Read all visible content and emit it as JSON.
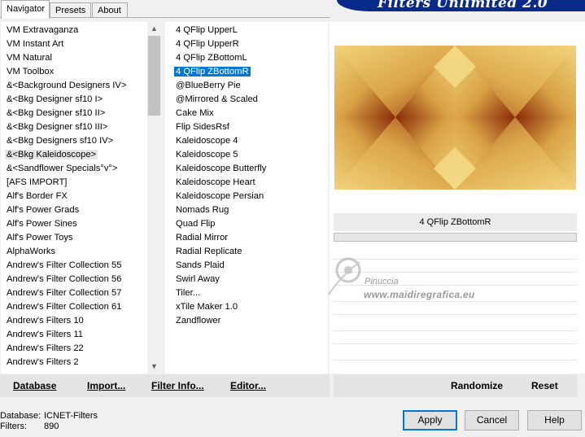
{
  "tabs": [
    "Navigator",
    "Presets",
    "About"
  ],
  "banner_title": "Filters Unlimited 2.0",
  "categories": [
    "VM Extravaganza",
    "VM Instant Art",
    "VM Natural",
    "VM Toolbox",
    "&<Background Designers IV>",
    "&<Bkg Designer sf10 I>",
    "&<Bkg Designer sf10 II>",
    "&<Bkg Designer sf10 III>",
    "&<Bkg Designers sf10 IV>",
    "&<Bkg Kaleidoscope>",
    "&<Sandflower Specials°v°>",
    "[AFS IMPORT]",
    "Alf's Border FX",
    "Alf's Power Grads",
    "Alf's Power Sines",
    "Alf's Power Toys",
    "AlphaWorks",
    "Andrew's Filter Collection 55",
    "Andrew's Filter Collection 56",
    "Andrew's Filter Collection 57",
    "Andrew's Filter Collection 61",
    "Andrew's Filters 10",
    "Andrew's Filters 11",
    "Andrew's Filters 22",
    "Andrew's Filters 2"
  ],
  "selected_category": "&<Bkg Kaleidoscope>",
  "filters": [
    "4 QFlip UpperL",
    "4 QFlip UpperR",
    "4 QFlip ZBottomL",
    "4 QFlip ZBottomR",
    "@BlueBerry Pie",
    "@Mirrored & Scaled",
    "Cake Mix",
    "Flip SidesRsf",
    "Kaleidoscope 4",
    "Kaleidoscope 5",
    "Kaleidoscope Butterfly",
    "Kaleidoscope Heart",
    "Kaleidoscope Persian",
    "Nomads Rug",
    "Quad Flip",
    "Radial Mirror",
    "Radial Replicate",
    "Sands Plaid",
    "Swirl Away",
    "Tiler...",
    "xTile Maker 1.0",
    "Zandflower"
  ],
  "selected_filter": "4 QFlip ZBottomR",
  "preview": {
    "filter_name": "4 QFlip ZBottomR",
    "colors": {
      "light": "#f2d27a",
      "mid": "#d9a245",
      "dark": "#8a2a08"
    }
  },
  "watermark": {
    "line1": "Pinuccia",
    "line2": "www.maidiregrafica.eu"
  },
  "bottom_links": {
    "database": "Database",
    "import": "Import...",
    "filter_info": "Filter Info...",
    "editor": "Editor...",
    "randomize": "Randomize",
    "reset": "Reset"
  },
  "status": {
    "database_label": "Database:",
    "database_value": "ICNET-Filters",
    "filters_label": "Filters:",
    "filters_value": "890"
  },
  "buttons": {
    "apply": "Apply",
    "cancel": "Cancel",
    "help": "Help"
  },
  "colors": {
    "selection": "#0078d7",
    "banner": "#0a2a8a"
  }
}
